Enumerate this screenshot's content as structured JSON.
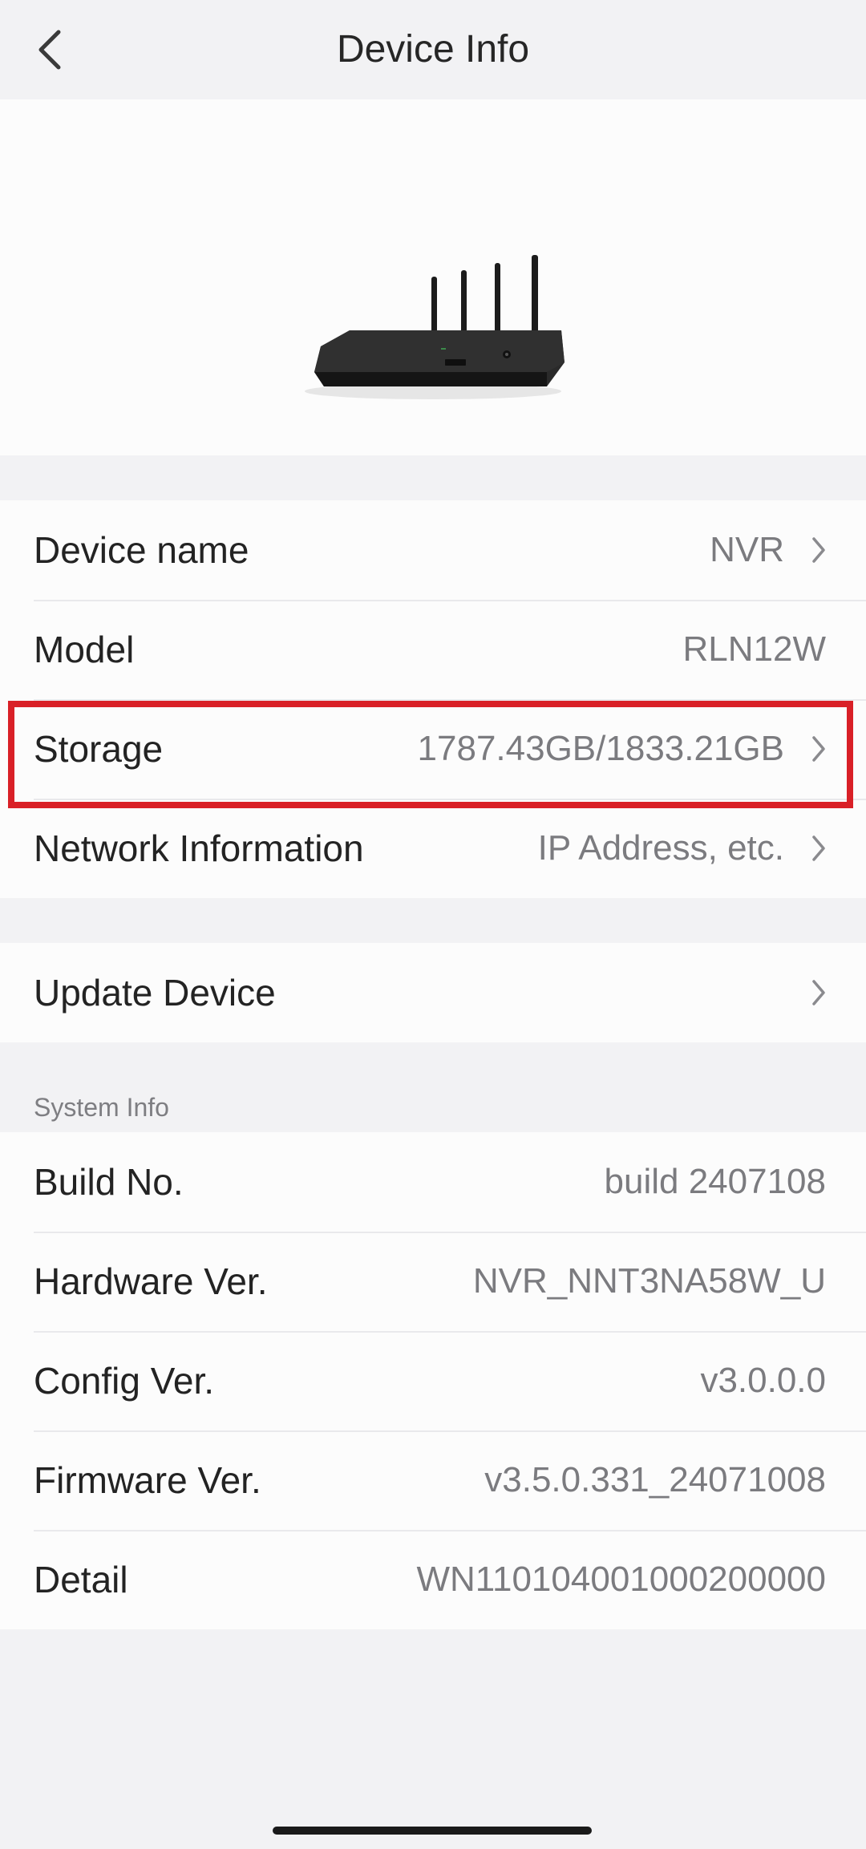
{
  "header": {
    "title": "Device Info",
    "back_icon": "chevron-left-icon"
  },
  "device_image": {
    "icon": "nvr-router-image"
  },
  "device_group": [
    {
      "label": "Device name",
      "value": "NVR",
      "chevron": true
    },
    {
      "label": "Model",
      "value": "RLN12W",
      "chevron": false
    },
    {
      "label": "Storage",
      "value": "1787.43GB/1833.21GB",
      "chevron": true,
      "highlighted": true
    },
    {
      "label": "Network Information",
      "value": "IP Address, etc.",
      "chevron": true
    }
  ],
  "update_group": [
    {
      "label": "Update Device",
      "value": "",
      "chevron": true
    }
  ],
  "system_info": {
    "section_label": "System Info",
    "rows": [
      {
        "label": "Build No.",
        "value": "build 2407108"
      },
      {
        "label": "Hardware Ver.",
        "value": "NVR_NNT3NA58W_U"
      },
      {
        "label": "Config Ver.",
        "value": "v3.0.0.0"
      },
      {
        "label": "Firmware Ver.",
        "value": "v3.5.0.331_24071008"
      },
      {
        "label": "Detail",
        "value": "WN110104001000200000"
      }
    ]
  },
  "colors": {
    "background": "#f2f2f4",
    "card": "#fcfcfc",
    "highlight": "#d92027",
    "value_text": "#7b7b7f"
  }
}
